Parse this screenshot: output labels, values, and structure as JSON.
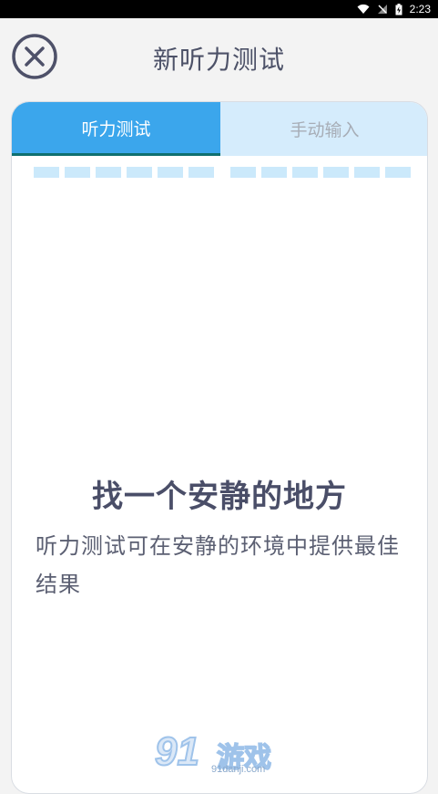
{
  "status_bar": {
    "time": "2:23",
    "icons": [
      "wifi-icon",
      "signal-off-icon",
      "battery-charging-icon"
    ]
  },
  "header": {
    "title": "新听力测试",
    "close_icon": "close-circle-icon"
  },
  "tabs": [
    {
      "label": "听力测试",
      "active": true
    },
    {
      "label": "手动输入",
      "active": false
    }
  ],
  "progress": {
    "total_segments": 12,
    "completed_segments": 0
  },
  "content": {
    "headline": "找一个安静的地方",
    "description": "听力测试可在安静的环境中提供最佳结果"
  },
  "watermark": {
    "number": "91",
    "brand": "游戏",
    "url": "91danji.com"
  },
  "colors": {
    "accent": "#3ba6ec",
    "tab_inactive": "#d5ecfc",
    "tab_indicator": "#0f7070",
    "segment": "#cbe9fb",
    "text_dark": "#4a4e68"
  }
}
